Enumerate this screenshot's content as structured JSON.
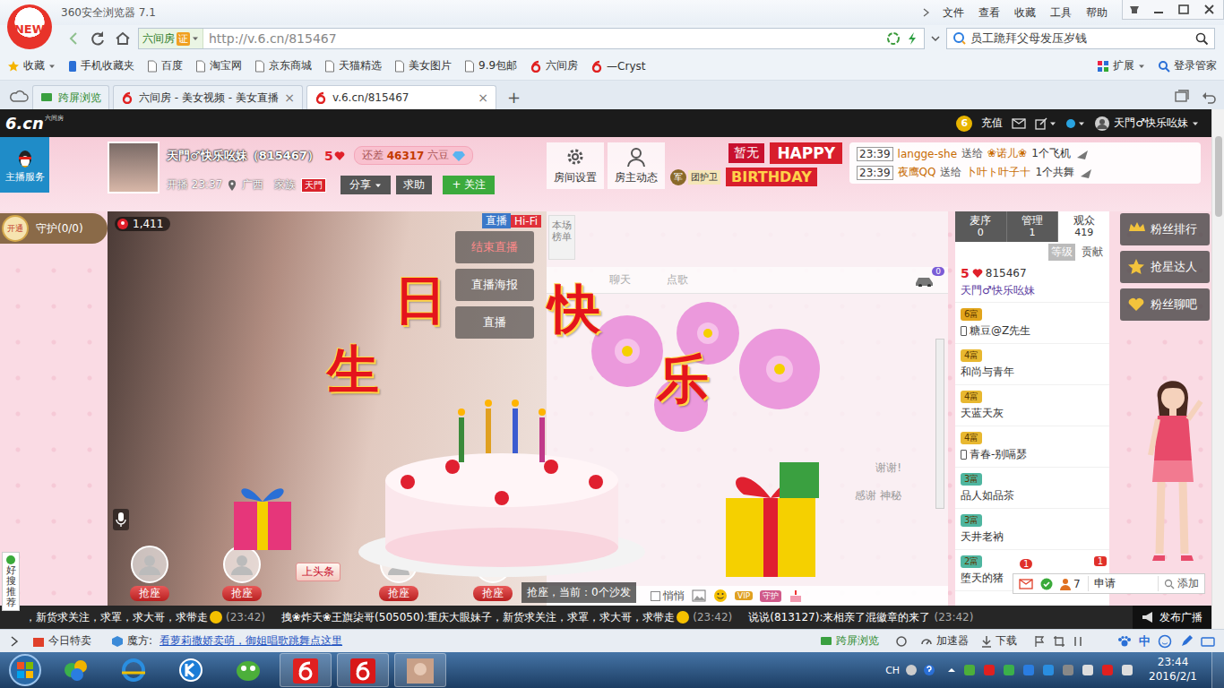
{
  "browser": {
    "title": "360安全浏览器 7.1",
    "logo": "NEW",
    "menu": [
      "文件",
      "查看",
      "收藏",
      "工具",
      "帮助"
    ],
    "address": {
      "site_badge": "六间房",
      "cert": "证",
      "url": "http://v.6.cn/815467"
    },
    "search": {
      "value": "员工跪拜父母发压岁钱"
    },
    "bookmarks": [
      {
        "label": "收藏",
        "kind": "menu"
      },
      {
        "label": "手机收藏夹",
        "kind": "phone"
      },
      {
        "label": "百度",
        "kind": "page"
      },
      {
        "label": "淘宝网",
        "kind": "page"
      },
      {
        "label": "京东商城",
        "kind": "page"
      },
      {
        "label": "天猫精选",
        "kind": "page"
      },
      {
        "label": "美女图片",
        "kind": "page"
      },
      {
        "label": "9.9包邮",
        "kind": "page"
      },
      {
        "label": "六间房",
        "kind": "six"
      },
      {
        "label": "—Cryst",
        "kind": "six"
      }
    ],
    "bookmark_tools": [
      "扩展",
      "登录管家"
    ],
    "tabs": [
      {
        "label": "跨屏浏览",
        "selected": false,
        "kind": "cross"
      },
      {
        "label": "六间房 - 美女视频 - 美女直播",
        "selected": false,
        "kind": "site",
        "close": "×"
      },
      {
        "label": "v.6.cn/815467",
        "selected": true,
        "kind": "site",
        "close": "×"
      }
    ],
    "new_tab": "+"
  },
  "site": {
    "logo": "6.cn",
    "logo_sub": "六间房",
    "nav": {
      "coin": "6",
      "recharge": "充值",
      "user": "天門♂快乐吆妹"
    },
    "service": "主播服务",
    "room": {
      "name": "天門♂快乐吆妹（815467）",
      "level": "5",
      "need_label": "还差",
      "need_value": "46317",
      "need_unit": "六豆",
      "start": "开播 23:37",
      "location": "广西",
      "family_label": "家族",
      "family": "天門",
      "share": "分享",
      "help": "求助",
      "follow": "+ 关注"
    },
    "room_buttons": [
      "房间设置",
      "房主动态"
    ],
    "banner": {
      "status": "暂无",
      "badge": "军",
      "guard": "团护卫",
      "happy": "HAPPY",
      "birthday": "BIRTHDAY"
    },
    "gift_feed": [
      {
        "time": "23:39",
        "from": "langge-she",
        "verb": "送给",
        "to": "❀诺儿❀",
        "gift": "1个飞机"
      },
      {
        "time": "23:39",
        "from": "夜鹰QQ",
        "verb": "送给",
        "to": "卜叶ト叶子十",
        "gift": "1个共舞"
      }
    ],
    "guard": {
      "open": "开通",
      "label": "守护(0/0)"
    },
    "video": {
      "viewers": "1,411",
      "live": "直播",
      "quality": "Hi-Fi",
      "controls": [
        "结束直播",
        "直播海报",
        "直播"
      ],
      "seats": [
        "抢座",
        "抢座",
        "抢座",
        "抢座"
      ],
      "headline": "上头条"
    },
    "sofa": "抢座，当前：0个沙发",
    "gift_text": [
      "生",
      "日",
      "快",
      "乐"
    ],
    "chat": {
      "rank": "本场榜单",
      "tabs": [
        "聊天",
        "点歌"
      ],
      "car_count": "0",
      "messages": [
        "谢谢!",
        "感谢 神秘"
      ],
      "whisper": {
        "label": "悄悄",
        "checked": false
      },
      "tools": [
        "VIP",
        "守护"
      ]
    },
    "audience": {
      "tabs": [
        {
          "label": "麦序",
          "count": "0",
          "selected": false
        },
        {
          "label": "管理",
          "count": "1",
          "selected": false
        },
        {
          "label": "观众",
          "count": "419",
          "selected": true
        }
      ],
      "sort": [
        {
          "label": "等级",
          "selected": true
        },
        {
          "label": "贡献",
          "selected": false
        }
      ],
      "users": [
        {
          "rank": "5",
          "id": "815467",
          "name": "天門♂快乐吆妹",
          "kind": "host",
          "mobile": false,
          "color": "#e0202a"
        },
        {
          "rank": "6富",
          "name": "糖豆@Z先生",
          "kind": "rich",
          "mobile": true,
          "color": "#e2a51c"
        },
        {
          "rank": "4富",
          "name": "和尚与青年",
          "kind": "rich",
          "mobile": false,
          "color": "#e8b830"
        },
        {
          "rank": "4富",
          "name": "天蓝天灰",
          "kind": "rich",
          "mobile": false,
          "color": "#e8b830"
        },
        {
          "rank": "4富",
          "name": "青春-别嗝瑟",
          "kind": "rich",
          "mobile": true,
          "color": "#e8b830"
        },
        {
          "rank": "3富",
          "name": "品人如品茶",
          "kind": "rich",
          "mobile": false,
          "color": "#4fb6a0"
        },
        {
          "rank": "3富",
          "name": "天井老衲",
          "kind": "rich",
          "mobile": false,
          "color": "#4fb6a0"
        },
        {
          "rank": "2富",
          "name": "堕天的猪",
          "kind": "rich",
          "mobile": false,
          "color": "#4fb6a0"
        }
      ]
    },
    "toolbar": {
      "mail_badge": "1",
      "online": "7",
      "apply": "申请",
      "apply_badge": "1",
      "add": "添加"
    },
    "side_buttons": [
      "粉丝排行",
      "抢星达人",
      "粉丝聊吧"
    ],
    "recommend": "好搜推荐",
    "ticker": {
      "items": [
        {
          "msg": "，新货求关注，求罩，求大哥，求带走",
          "emoji": true,
          "time": "(23:42)"
        },
        {
          "name": "拽❀炸天❀王旗柒哥(505050):",
          "msg": " 重庆大眼妹子，新货求关注，求罩，求大哥，求带走",
          "emoji": true,
          "time": "(23:42)"
        },
        {
          "name": "说说(813127):",
          "msg": " 来相亲了混徽章的来了",
          "emoji": false,
          "time": "(23:42)"
        }
      ],
      "publish": "发布广播"
    }
  },
  "status_bar": {
    "sale": "今日特卖",
    "mofang": "魔方:",
    "promo": "看萝莉撒娇卖萌，御姐唱歌跳舞点这里",
    "cross": "跨屏浏览",
    "accel": "加速器",
    "download": "下载",
    "ime": "中"
  },
  "taskbar": {
    "lang": "CH",
    "time": "23:44",
    "date": "2016/2/1"
  }
}
